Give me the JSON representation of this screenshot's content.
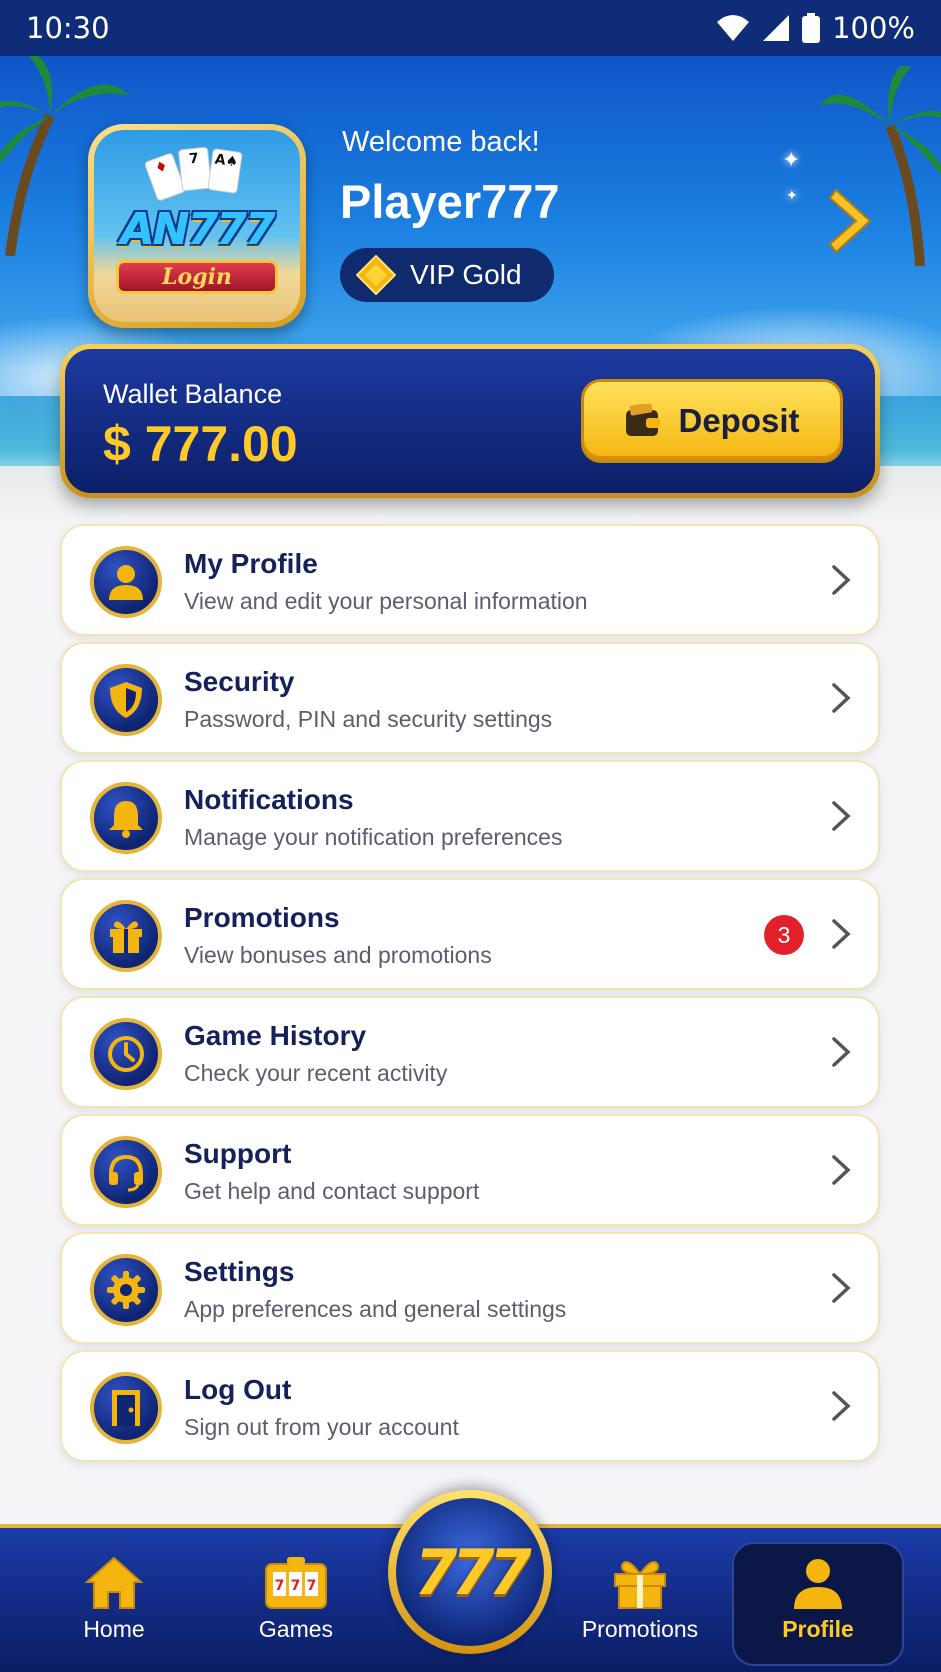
{
  "status_bar": {
    "time": "10:30",
    "battery": "100%",
    "icons": [
      "wifi-icon",
      "signal-icon",
      "battery-icon"
    ]
  },
  "header": {
    "logo_text": "AN777",
    "logo_ribbon": "Login",
    "welcome": "Welcome back!",
    "player_name": "Player777",
    "vip_label": "VIP Gold"
  },
  "wallet": {
    "label": "Wallet Balance",
    "amount": "$ 777.00",
    "deposit_label": "Deposit"
  },
  "menu": {
    "items": [
      {
        "title": "My Profile",
        "desc": "View and edit your personal information",
        "icon": "user-icon"
      },
      {
        "title": "Security",
        "desc": "Password, PIN and security settings",
        "icon": "shield-icon"
      },
      {
        "title": "Notifications",
        "desc": "Manage your notification preferences",
        "icon": "bell-icon"
      },
      {
        "title": "Promotions",
        "desc": "View bonuses and promotions",
        "icon": "gift-icon",
        "badge": "3"
      },
      {
        "title": "Game History",
        "desc": "Check your recent activity",
        "icon": "clock-icon"
      },
      {
        "title": "Support",
        "desc": "Get help and contact support",
        "icon": "headset-icon"
      },
      {
        "title": "Settings",
        "desc": "App preferences and general settings",
        "icon": "gear-icon"
      },
      {
        "title": "Log Out",
        "desc": "Sign out from your account",
        "icon": "door-icon"
      }
    ]
  },
  "bottom_nav": {
    "items": [
      {
        "label": "Home",
        "icon": "home-icon"
      },
      {
        "label": "Games",
        "icon": "slot-machine-icon"
      },
      {
        "label": "Promotions",
        "icon": "gift-icon"
      },
      {
        "label": "Profile",
        "icon": "user-icon",
        "active": true
      }
    ],
    "center_label": "777"
  },
  "colors": {
    "navy": "#0f2c79",
    "gold": "#ffc928",
    "badge_red": "#e3202a"
  }
}
